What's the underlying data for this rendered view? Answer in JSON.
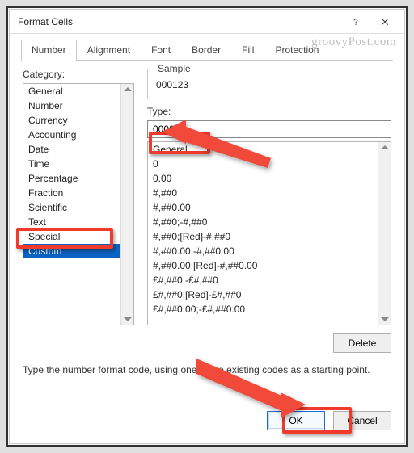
{
  "window": {
    "title": "Format Cells"
  },
  "tabs": {
    "items": [
      "Number",
      "Alignment",
      "Font",
      "Border",
      "Fill",
      "Protection"
    ],
    "active_index": 0
  },
  "category": {
    "label": "Category:",
    "items": [
      "General",
      "Number",
      "Currency",
      "Accounting",
      "Date",
      "Time",
      "Percentage",
      "Fraction",
      "Scientific",
      "Text",
      "Special",
      "Custom"
    ],
    "selected_index": 11
  },
  "sample": {
    "label": "Sample",
    "value": "000123"
  },
  "type": {
    "label": "Type:",
    "value": "000000"
  },
  "formats": {
    "items": [
      "General",
      "0",
      "0.00",
      "#,##0",
      "#,##0.00",
      "#,##0;-#,##0",
      "#,##0;[Red]-#,##0",
      "#,##0.00;-#,##0.00",
      "#,##0.00;[Red]-#,##0.00",
      "£#,##0;-£#,##0",
      "£#,##0;[Red]-£#,##0",
      "£#,##0.00;-£#,##0.00"
    ]
  },
  "buttons": {
    "delete": "Delete",
    "ok": "OK",
    "cancel": "Cancel"
  },
  "hint": "Type the number format code, using one of the existing codes as a starting point.",
  "watermark": "groovyPost.com",
  "colors": {
    "accent": "#0a63c2",
    "callout": "#f03a2c"
  },
  "chart_data": {
    "type": "table",
    "note": "Not a chart image."
  }
}
